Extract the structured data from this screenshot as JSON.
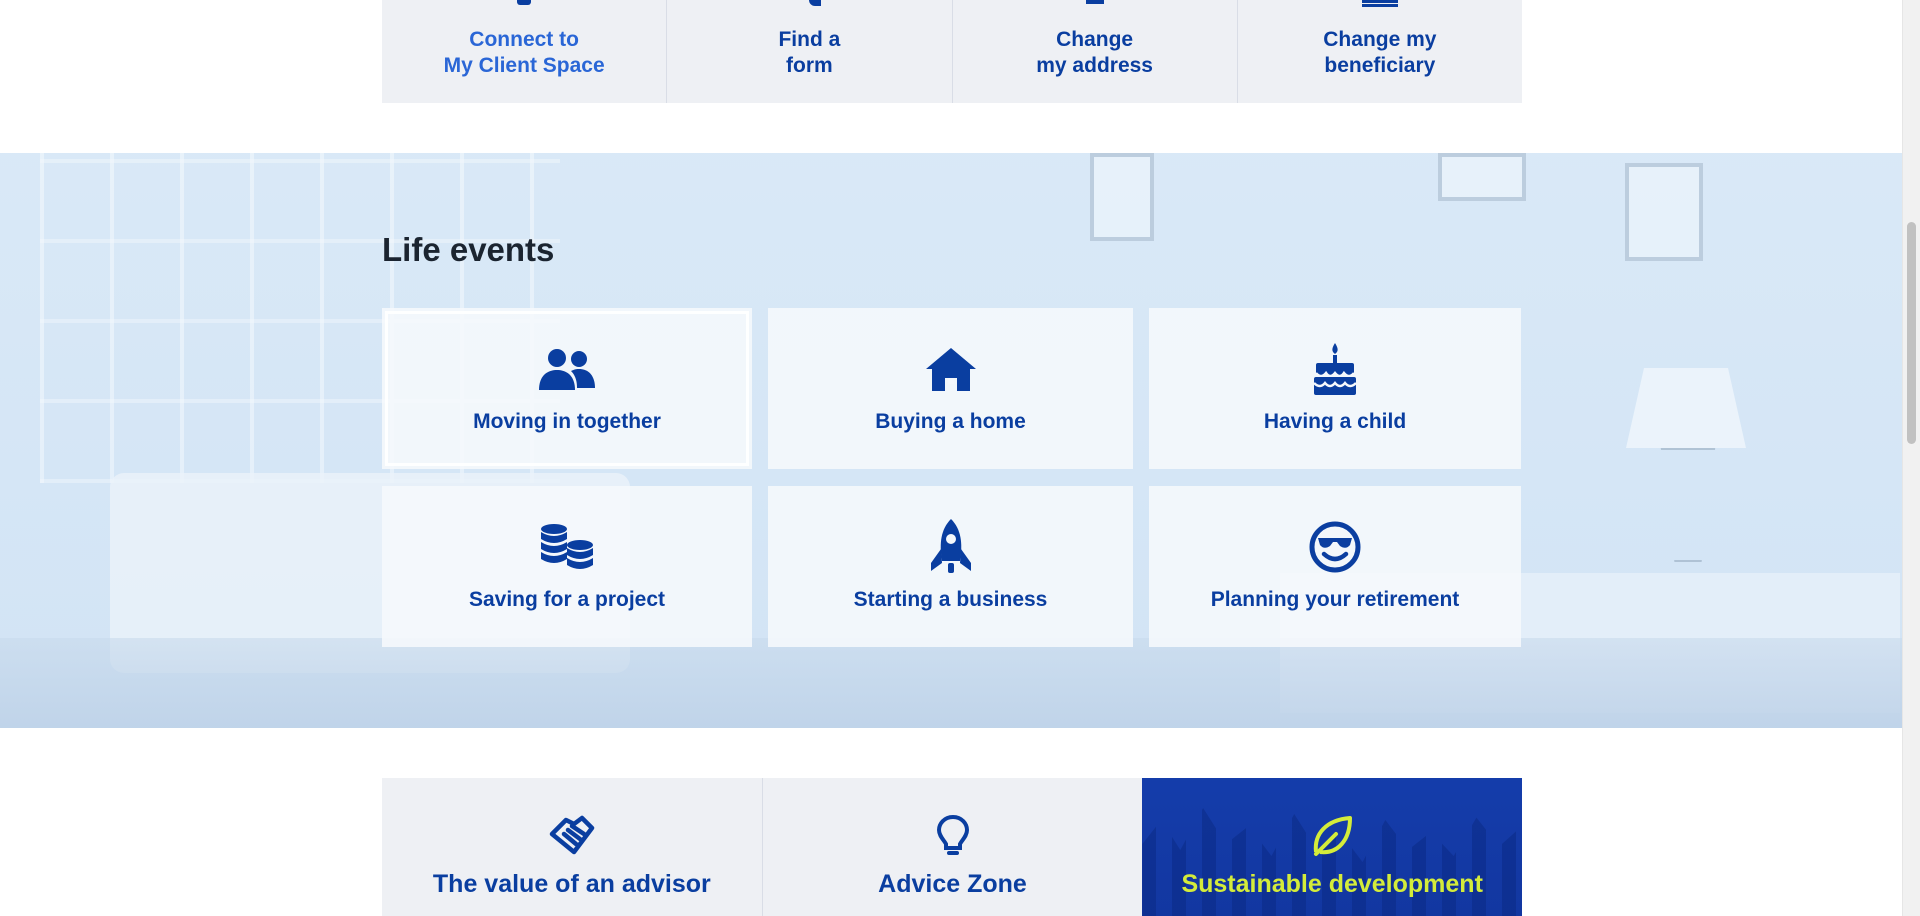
{
  "quick_links": [
    {
      "line1": "Connect to",
      "line2": "My Client Space"
    },
    {
      "line1": "Find a",
      "line2": "form"
    },
    {
      "line1": "Change",
      "line2": "my address"
    },
    {
      "line1": "Change my",
      "line2": "beneficiary"
    }
  ],
  "life_events": {
    "title": "Life events",
    "items": [
      {
        "label": "Moving in together",
        "icon": "people-icon"
      },
      {
        "label": "Buying a home",
        "icon": "house-icon"
      },
      {
        "label": "Having a child",
        "icon": "cake-icon"
      },
      {
        "label": "Saving for a project",
        "icon": "coins-icon"
      },
      {
        "label": "Starting a business",
        "icon": "rocket-icon"
      },
      {
        "label": "Planning your retirement",
        "icon": "sunglasses-smiley-icon"
      }
    ]
  },
  "bottom_cards": [
    {
      "label": "The value of an advisor",
      "icon": "handshake-icon"
    },
    {
      "label": "Advice Zone",
      "icon": "lightbulb-icon"
    },
    {
      "label": "Sustainable development",
      "icon": "leaf-icon"
    }
  ],
  "colors": {
    "brand_blue": "#0a3ea0",
    "active_link_blue": "#2a66d6",
    "heading_dark": "#1b2430",
    "card_grey": "#eef0f4",
    "feature_green": "#d4ec3a"
  }
}
